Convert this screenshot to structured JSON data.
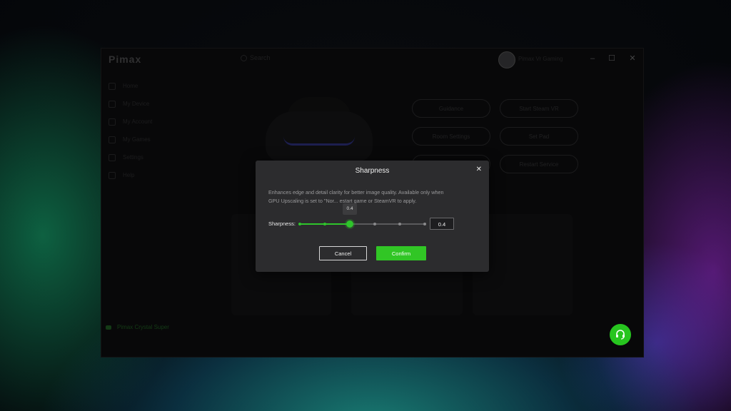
{
  "app": {
    "logo": "Pimax",
    "search_placeholder": "Search",
    "user_name": "Pimax Vr Gaming",
    "window_controls": [
      "minimize",
      "maximize",
      "close"
    ]
  },
  "sidebar": {
    "items": [
      {
        "label": "Home",
        "icon": "home-icon"
      },
      {
        "label": "My Device",
        "icon": "device-icon"
      },
      {
        "label": "My Account",
        "icon": "account-icon"
      },
      {
        "label": "My Games",
        "icon": "games-icon"
      },
      {
        "label": "Settings",
        "icon": "settings-icon"
      },
      {
        "label": "Help",
        "icon": "help-icon"
      }
    ],
    "device_status": "Pimax Crystal Super"
  },
  "main": {
    "quick_buttons": [
      "Guidance",
      "Start Steam VR",
      "Room Settings",
      "Set Pad",
      "",
      "Restart Service"
    ]
  },
  "dialog": {
    "title": "Sharpness",
    "close_icon": "close-icon",
    "description_line1": "Enhances edge and detail clarity for better image quality. Available only when",
    "description_line2": "GPU Upscaling is set to \"Nor... estart game or SteamVR to apply.",
    "slider_label": "Sharpness:",
    "slider": {
      "min": 0,
      "max": 1,
      "step": 0.2,
      "value": 0.4
    },
    "tooltip_value": "0.4",
    "value_input": "0.4",
    "cancel_label": "Cancel",
    "confirm_label": "Confirm"
  },
  "colors": {
    "accent": "#2fc52b",
    "dialog_bg": "#2c2c2e",
    "app_bg": "#0d0d0e"
  }
}
